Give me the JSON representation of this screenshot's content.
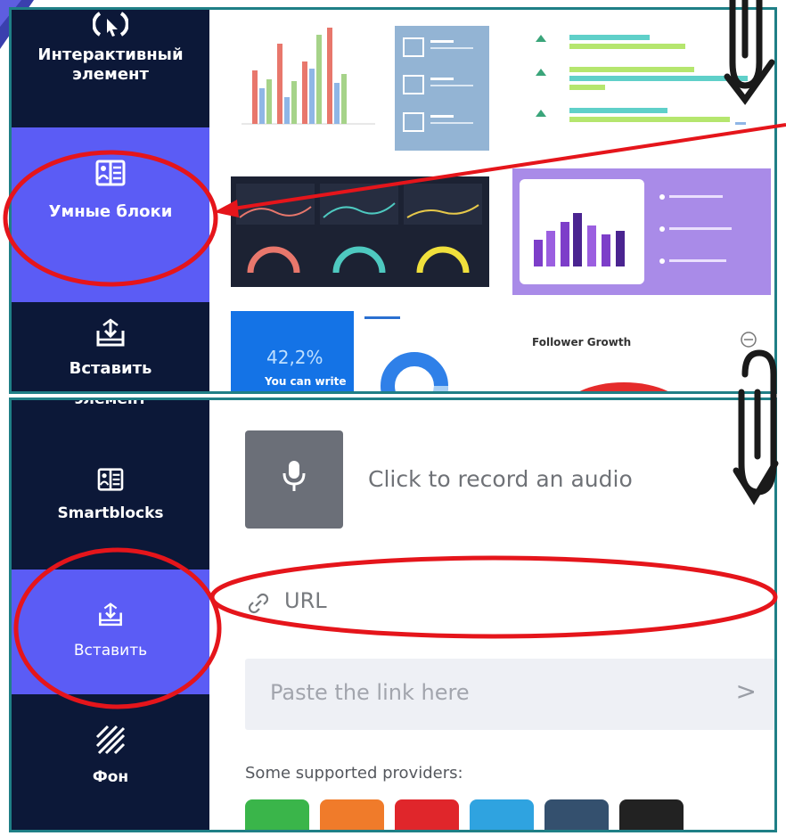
{
  "top_panel": {
    "sidebar": {
      "items": [
        {
          "label_line1": "Интерактивный",
          "label_line2": "элемент",
          "icon": "interactive-cursor-icon",
          "active": false
        },
        {
          "label": "Умные блоки",
          "icon": "smartblocks-icon",
          "active": true
        },
        {
          "label": "Вставить",
          "icon": "embed-icon",
          "active": false
        }
      ]
    },
    "thumbnails": {
      "donut_percent": "42,2%",
      "donut_caption": "You can write",
      "follower_title": "Follower Growth"
    }
  },
  "bottom_panel": {
    "sidebar": {
      "cut_label": "элемент",
      "items": [
        {
          "label": "Smartblocks",
          "icon": "smartblocks-icon",
          "active": false
        },
        {
          "label": "Вставить",
          "icon": "embed-icon",
          "active": true
        },
        {
          "label": "Фон",
          "icon": "background-stripes-icon",
          "active": false
        }
      ]
    },
    "audio": {
      "icon": "microphone-icon",
      "text": "Click to record an audio"
    },
    "url": {
      "icon": "link-icon",
      "label": "URL"
    },
    "paste": {
      "placeholder": "Paste the link here",
      "chevron": ">"
    },
    "providers_label": "Some supported providers:",
    "providers": [
      {
        "name": "green-provider-icon",
        "color": "#3ab54a"
      },
      {
        "name": "orange-provider-icon",
        "color": "#f07b2a"
      },
      {
        "name": "red-provider-icon",
        "color": "#e0262b"
      },
      {
        "name": "blue-provider-icon",
        "color": "#2fa3e0"
      },
      {
        "name": "navy-provider-icon",
        "color": "#34506e"
      },
      {
        "name": "black-provider-icon",
        "color": "#222222"
      }
    ]
  },
  "colors": {
    "sidebar_bg": "#0c1838",
    "active_bg": "#5b5cf5",
    "panel_border": "#1f7f86",
    "highlight": "#e5151b"
  }
}
